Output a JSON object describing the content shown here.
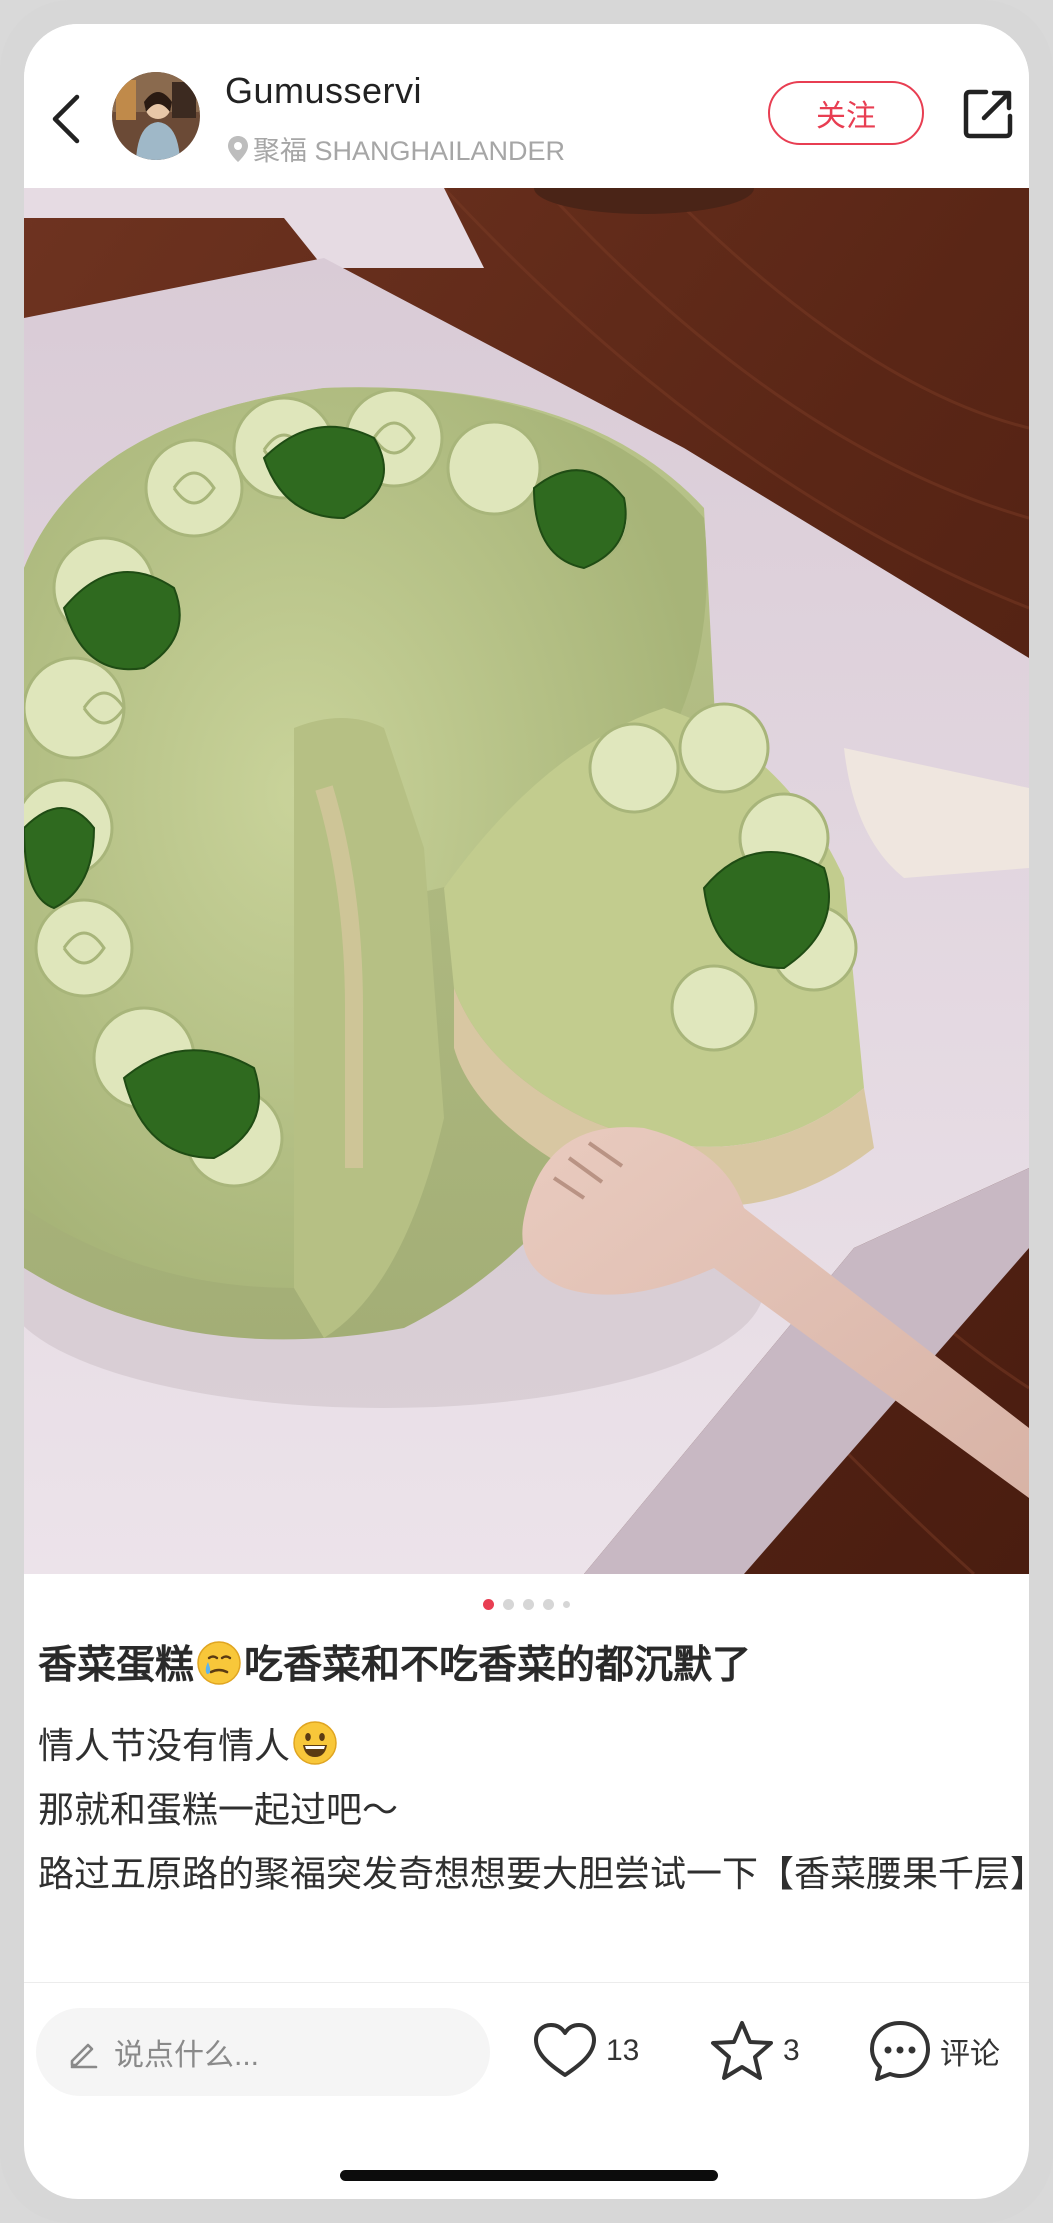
{
  "header": {
    "username": "Gumusservi",
    "location": "聚福 SHANGHAILANDER",
    "follow_label": "关注"
  },
  "post": {
    "title_before_emoji": "香菜蛋糕",
    "title_after_emoji": "吃香菜和不吃香菜的都沉默了",
    "line1_text": "情人节没有情人",
    "line2_text": "那就和蛋糕一起过吧～",
    "line3_text": "路过五原路的聚福突发奇想想要大胆尝试一下【香菜腰果千层】",
    "carousel": {
      "count": 5,
      "active_index": 0
    }
  },
  "bottom_bar": {
    "comment_placeholder": "说点什么...",
    "likes": "13",
    "collects": "3",
    "comment_label": "评论"
  },
  "colors": {
    "accent": "#e83e52",
    "text_primary": "#2a2a2a",
    "text_muted": "#a6a6a6"
  },
  "icons": [
    "back-arrow-icon",
    "location-pin-icon",
    "share-icon",
    "pencil-icon",
    "heart-icon",
    "star-icon",
    "chat-bubble-icon"
  ]
}
